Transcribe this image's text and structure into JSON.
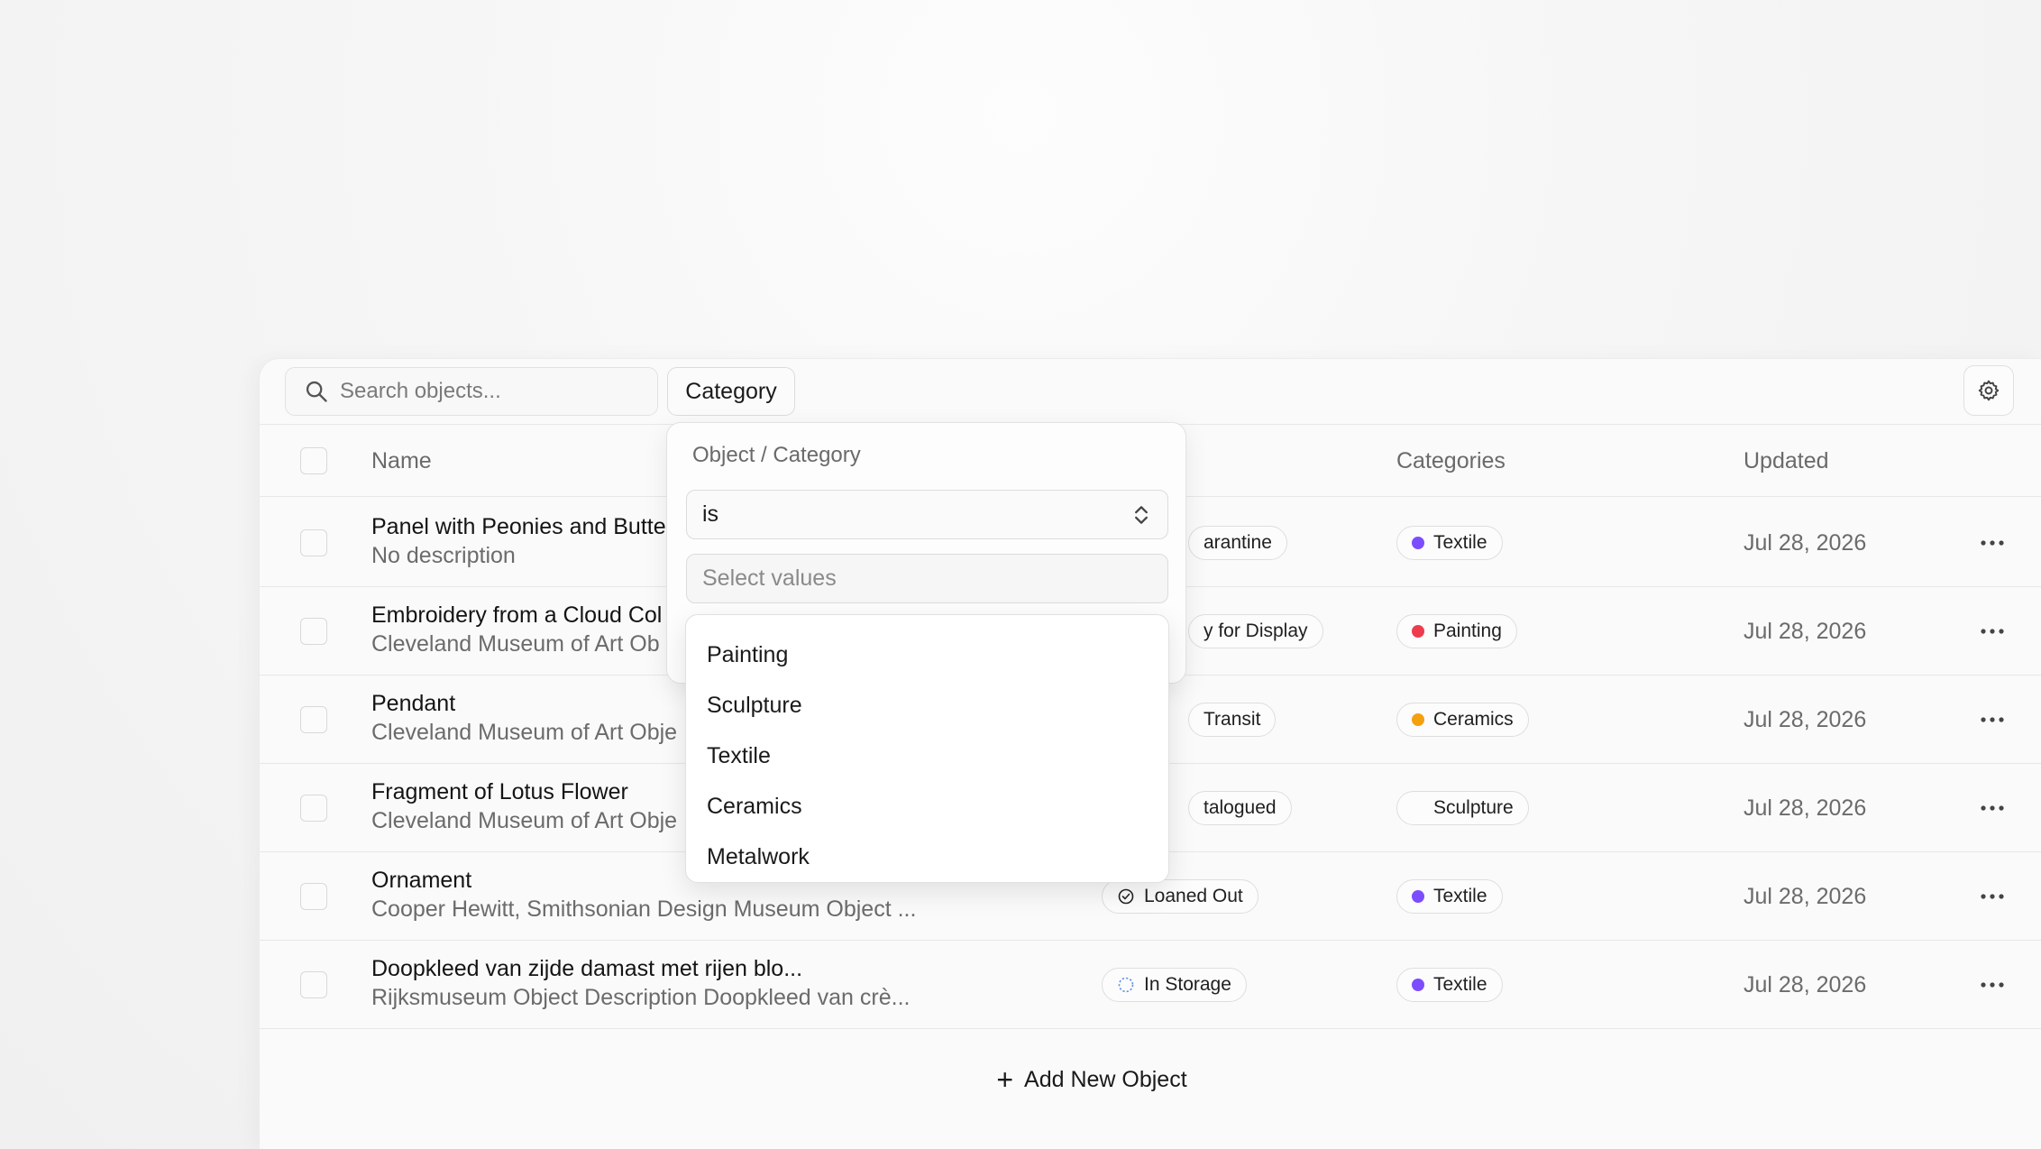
{
  "toolbar": {
    "search_placeholder": "Search objects...",
    "category_button": "Category"
  },
  "table": {
    "columns": {
      "name": "Name",
      "categories": "Categories",
      "updated": "Updated"
    },
    "rows": [
      {
        "title": "Panel with Peonies and Butte",
        "desc": "No description",
        "status": "arantine",
        "status_icon": "none",
        "category": "Textile",
        "category_color": "#7c4dff",
        "updated": "Jul 28, 2026"
      },
      {
        "title": "Embroidery from a Cloud Col",
        "desc": "Cleveland Museum of Art Ob",
        "status": "y for Display",
        "status_icon": "none",
        "category": "Painting",
        "category_color": "#ef3b4e",
        "updated": "Jul 28, 2026"
      },
      {
        "title": "Pendant",
        "desc": "Cleveland Museum of Art Obje",
        "status": "Transit",
        "status_icon": "none",
        "category": "Ceramics",
        "category_color": "#f5a00f",
        "updated": "Jul 28, 2026"
      },
      {
        "title": "Fragment of Lotus Flower",
        "desc": "Cleveland Museum of Art Obje",
        "status": "talogued",
        "status_icon": "none",
        "category": "Sculpture",
        "category_color": "",
        "updated": "Jul 28, 2026"
      },
      {
        "title": "Ornament",
        "desc": "Cooper Hewitt, Smithsonian Design Museum Object ...",
        "status": "Loaned Out",
        "status_icon": "check-circle-icon",
        "category": "Textile",
        "category_color": "#7c4dff",
        "updated": "Jul 28, 2026"
      },
      {
        "title": "Doopkleed van zijde damast met rijen blo...",
        "desc": "Rijksmuseum Object Description Doopkleed van crè...",
        "status": "In Storage",
        "status_icon": "dashed-circle-icon",
        "category": "Textile",
        "category_color": "#7c4dff",
        "updated": "Jul 28, 2026"
      }
    ],
    "add_label": "Add New Object"
  },
  "filter": {
    "title": "Object / Category",
    "operator": "is",
    "values_placeholder": "Select values",
    "options": [
      "Painting",
      "Sculpture",
      "Textile",
      "Ceramics",
      "Metalwork"
    ]
  },
  "icons": {
    "search": "search-icon",
    "settings": "gear-icon",
    "more": "more-horizontal-icon",
    "operator_chevron": "chevron-up-down-icon",
    "add": "plus-icon"
  }
}
